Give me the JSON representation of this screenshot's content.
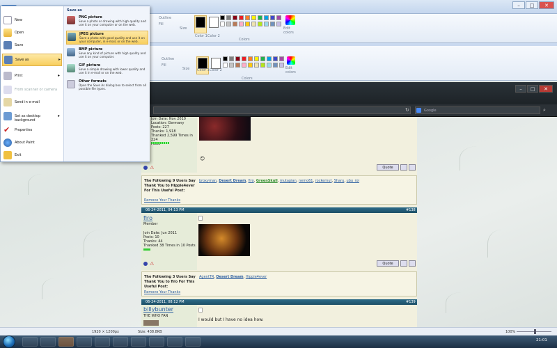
{
  "ribbon": {
    "outline": "Outline",
    "fill": "Fill",
    "size": "Size",
    "color1": "Color 1",
    "color2": "Color 2",
    "edit_colors": "Edit colors",
    "colors_group": "Colors",
    "palette": [
      "#000000",
      "#7f7f7f",
      "#880015",
      "#ed1c24",
      "#ff7f27",
      "#fff200",
      "#22b14c",
      "#00a2e8",
      "#3f48cc",
      "#a349a4",
      "#ffffff",
      "#c3c3c3",
      "#b97a57",
      "#ffaec9",
      "#ffc90e",
      "#efe4b0",
      "#b5e61d",
      "#99d9ea",
      "#7092be",
      "#c8bfe7"
    ]
  },
  "browser": {
    "search_placeholder": "Google"
  },
  "file_menu": {
    "items": [
      {
        "label": "New"
      },
      {
        "label": "Open"
      },
      {
        "label": "Save"
      },
      {
        "label": "Save as"
      },
      {
        "label": "Print"
      },
      {
        "label": "From scanner or camera"
      },
      {
        "label": "Send in e-mail"
      },
      {
        "label": "Set as desktop background"
      },
      {
        "label": "Properties"
      },
      {
        "label": "About Paint"
      },
      {
        "label": "Exit"
      }
    ],
    "submenu_title": "Save as",
    "submenu": [
      {
        "title": "PNG picture",
        "desc": "Save a photo or drawing with high quality and use it on your computer or on the web."
      },
      {
        "title": "JPEG picture",
        "desc": "Save a photo with good quality and use it on your computer, in e-mail, or on the web."
      },
      {
        "title": "BMP picture",
        "desc": "Save any kind of picture with high quality and use it on your computer."
      },
      {
        "title": "GIF picture",
        "desc": "Save a simple drawing with lower quality and use it in e-mail or on the web."
      },
      {
        "title": "Other formats",
        "desc": "Open the Save As dialog box to select from all possible file types."
      }
    ]
  },
  "post1": {
    "details": [
      "Join Date: Nov 2010",
      "Location: Germany",
      "Posts: 227",
      "Thanks: 1,918",
      "Thanked 2,599 Times in 224",
      "Posts"
    ],
    "quote": "Quote"
  },
  "thanks1": {
    "title": "The Following 9 Users Say Thank You to Hippie4ever For This Useful Post:",
    "remove": "Remove Your Thanks",
    "users": [
      "broxyman",
      "Desert Dream",
      "firo",
      "GreenSkull",
      "mutapian",
      "nemo61",
      "rockernut",
      "Sharu",
      "ubu_roi"
    ]
  },
  "post2": {
    "date": "06-24-2011, 04:13 PM",
    "number": "#138",
    "username": "firo",
    "rank": "Member",
    "details": [
      "Join Date: Jun 2011",
      "Posts: 10",
      "Thanks: 44",
      "Thanked 38 Times in 10 Posts"
    ],
    "quote": "Quote"
  },
  "thanks2": {
    "title": "The Following 3 Users Say Thank You to firo For This Useful Post:",
    "remove": "Remove Your Thanks",
    "users": [
      "AgentTR",
      "Desert Dream",
      "Hippie4ever"
    ]
  },
  "post3": {
    "date": "06-24-2011, 08:12 PM",
    "number": "#139",
    "username": "billybunter",
    "rank": "THE WHO FAN",
    "text": "I would but I have no idea how."
  },
  "statusbar": {
    "dimensions": "1920 × 1200px",
    "size": "Size: 438.8KB",
    "zoom": "100%"
  },
  "taskbar": {
    "time": "21:01"
  }
}
